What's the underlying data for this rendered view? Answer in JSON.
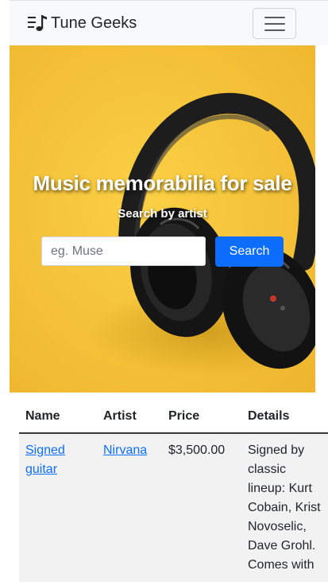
{
  "navbar": {
    "brand": "Tune Geeks",
    "icons": {
      "brand": "music-note-list-icon",
      "toggler": "hamburger-menu-icon"
    }
  },
  "hero": {
    "title": "Music memorabilia for sale",
    "subtitle": "Search by artist",
    "search_placeholder": "eg. Muse",
    "search_value": "",
    "search_button": "Search",
    "colors": {
      "background": "#f5c43a",
      "button": "#0d6efd"
    }
  },
  "table": {
    "headers": [
      "Name",
      "Artist",
      "Price",
      "Details"
    ],
    "rows": [
      {
        "name": "Signed guitar",
        "artist": "Nirvana",
        "price": "$3,500.00",
        "details": "Signed by classic lineup: Kurt Cobain, Krist Novoselic, Dave Grohl. Comes with"
      }
    ]
  }
}
